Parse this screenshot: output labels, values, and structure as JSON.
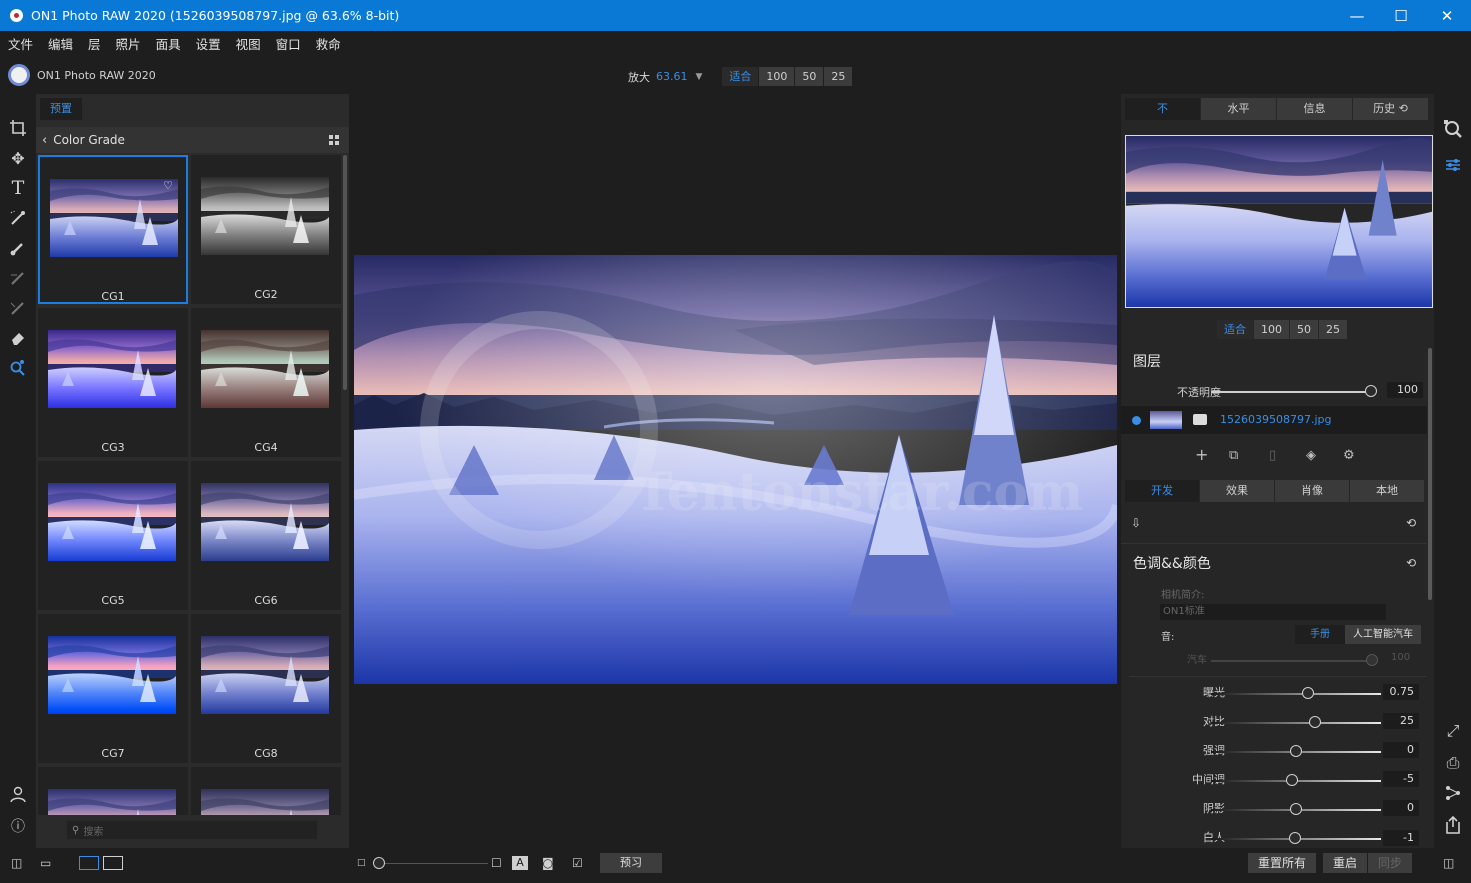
{
  "window": {
    "title": "ON1 Photo RAW 2020 (1526039508797.jpg @ 63.6% 8-bit)",
    "minimize": "—",
    "maximize": "☐",
    "close": "✕"
  },
  "menu": [
    "文件",
    "编辑",
    "层",
    "照片",
    "面具",
    "设置",
    "视图",
    "窗口",
    "救命"
  ],
  "brand": {
    "name": "ON1 Photo RAW 2020"
  },
  "zoom": {
    "label": "放大",
    "value": "63.61",
    "options": [
      "适合",
      "100",
      "50",
      "25"
    ],
    "active": "适合"
  },
  "left_panel": {
    "tab": "预置",
    "category": "Color Grade",
    "presets": [
      "CG1",
      "CG2",
      "CG3",
      "CG4",
      "CG5",
      "CG6",
      "CG7",
      "CG8"
    ],
    "search_placeholder": "搜索"
  },
  "right_panel": {
    "tabs": [
      "不",
      "水平",
      "信息",
      "历史 ⟲"
    ],
    "nav_zoom": [
      "适合",
      "100",
      "50",
      "25"
    ],
    "layers": {
      "title": "图层",
      "opacity_label": "不透明度",
      "opacity_value": "100",
      "opacity": 100,
      "layer_name": "1526039508797.jpg"
    },
    "module_tabs": [
      "开发",
      "效果",
      "肖像",
      "本地"
    ],
    "tone": {
      "title": "色调&&颜色",
      "camera_profile_label": "相机简介:",
      "camera_profile_value": "ON1标准",
      "tone_label": "音:",
      "mode_manual": "手册",
      "mode_ai": "人工智能汽车",
      "auto_label": "汽车",
      "auto_value": "100",
      "sliders": [
        {
          "label": "曝光",
          "value": "0.75",
          "position": 0.57
        },
        {
          "label": "对比",
          "value": "25",
          "position": 0.61
        },
        {
          "label": "强调",
          "value": "0",
          "position": 0.5
        },
        {
          "label": "中间调",
          "value": "-5",
          "position": 0.475
        },
        {
          "label": "阴影",
          "value": "0",
          "position": 0.5
        },
        {
          "label": "白人",
          "value": "-1",
          "position": 0.495
        }
      ]
    }
  },
  "bottom": {
    "preview": "预习",
    "reset_all": "重置所有",
    "reset": "重启",
    "sync": "同步"
  },
  "colors": {
    "accent": "#3a8ee6",
    "titlebar": "#0a79d6",
    "selection": "#1a7ee0"
  }
}
